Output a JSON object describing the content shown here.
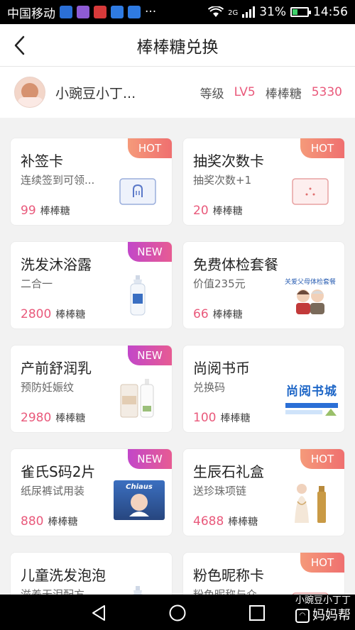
{
  "status_bar": {
    "carrier": "中国移动",
    "more": "···",
    "network": "2G",
    "battery": "31%",
    "battery_level": 0.31,
    "time": "14:56"
  },
  "header": {
    "title": "棒棒糖兑换",
    "back_icon": "chevron-left-icon"
  },
  "user": {
    "name": "小豌豆小丁...",
    "level_label": "等级",
    "level_value": "LV5",
    "candy_label": "棒棒糖",
    "candy_value": "5330"
  },
  "unit": "棒棒糖",
  "accent_color": "#e9597b",
  "items": [
    {
      "title": "补签卡",
      "subtitle": "连续签到可领...",
      "price": "99",
      "unit": "棒棒糖",
      "badge": "HOT",
      "badge_type": "hot",
      "icon": "sign-card-icon"
    },
    {
      "title": "抽奖次数卡",
      "subtitle": "抽奖次数+1",
      "price": "20",
      "unit": "棒棒糖",
      "badge": "HOT",
      "badge_type": "hot",
      "icon": "lottery-card-icon"
    },
    {
      "title": "洗发沐浴露",
      "subtitle": "二合一",
      "price": "2800",
      "unit": "棒棒糖",
      "badge": "NEW",
      "badge_type": "new",
      "icon": "shampoo-bottle-icon"
    },
    {
      "title": "免费体检套餐",
      "subtitle": "价值235元",
      "price": "66",
      "unit": "棒棒糖",
      "badge": "",
      "badge_type": "none",
      "icon": "parents-checkup-icon",
      "image_text": "关爱父母体检套餐"
    },
    {
      "title": "产前舒润乳",
      "subtitle": "预防妊娠纹",
      "price": "2980",
      "unit": "棒棒糖",
      "badge": "NEW",
      "badge_type": "new",
      "icon": "lotion-bottle-icon"
    },
    {
      "title": "尚阅书币",
      "subtitle": "兑换码",
      "price": "100",
      "unit": "棒棒糖",
      "badge": "",
      "badge_type": "none",
      "icon": "shangyue-book-icon",
      "image_text": "尚阅书城"
    },
    {
      "title": "雀氏S码2片",
      "subtitle": "纸尿裤试用装",
      "price": "880",
      "unit": "棒棒糖",
      "badge": "NEW",
      "badge_type": "new",
      "icon": "diaper-pack-icon",
      "image_text": "Chiaus"
    },
    {
      "title": "生辰石礼盒",
      "subtitle": "送珍珠项链",
      "price": "4688",
      "unit": "棒棒糖",
      "badge": "HOT",
      "badge_type": "hot",
      "icon": "gift-box-icon"
    },
    {
      "title": "儿童洗发泡泡",
      "subtitle": "滋养无泪配方",
      "price": "",
      "unit": "",
      "badge": "",
      "badge_type": "none",
      "icon": "kids-shampoo-icon"
    },
    {
      "title": "粉色昵称卡",
      "subtitle": "粉色昵称与众...",
      "price": "",
      "unit": "",
      "badge": "HOT",
      "badge_type": "hot",
      "icon": "nickname-card-icon"
    }
  ],
  "watermark": {
    "user": "小豌豆小丁丁",
    "brand": "妈妈帮"
  }
}
